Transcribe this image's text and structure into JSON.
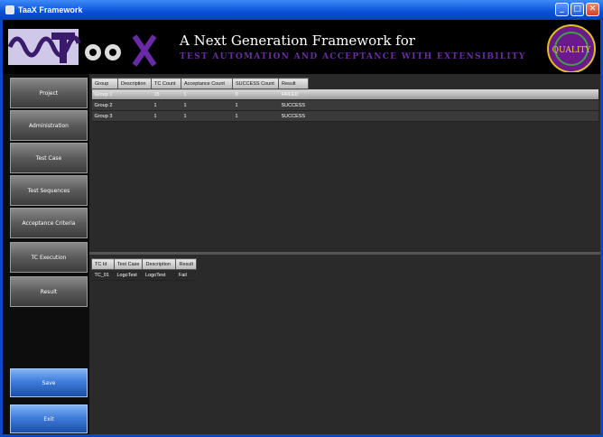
{
  "window": {
    "title": "TaaX Framework"
  },
  "banner": {
    "logo_text": "aaX",
    "tagline": "A Next Generation Framework for",
    "subtagline": "TEST AUTOMATION AND ACCEPTANCE WITH EXTENSIBILITY",
    "badge_text": "QUALITY"
  },
  "nav": {
    "items": [
      "Project",
      "Administration",
      "Test Case",
      "Test Sequences",
      "Acceptance Criteria",
      "TC Execution",
      "Result"
    ],
    "save": "Save",
    "exit": "Exit"
  },
  "groups_table": {
    "headers": [
      "Group",
      "Description",
      "TC Count",
      "Acceptance Count",
      "SUCCESS Count",
      "Result"
    ],
    "rows": [
      [
        "Group 1",
        "",
        "15",
        "1",
        "0",
        "FAILED"
      ],
      [
        "Group 2",
        "",
        "1",
        "1",
        "1",
        "SUCCESS"
      ],
      [
        "Group 3",
        "",
        "1",
        "1",
        "1",
        "SUCCESS"
      ]
    ]
  },
  "tc_table": {
    "headers": [
      "TC Id",
      "Test Case",
      "Description",
      "Result"
    ],
    "rows": [
      [
        "TC_01",
        "LogoTest",
        "LogoTest",
        "Fail"
      ]
    ]
  }
}
